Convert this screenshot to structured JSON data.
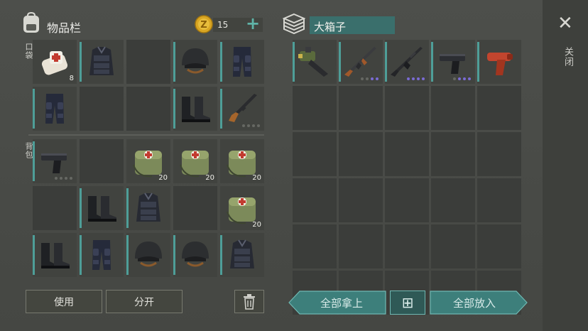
{
  "header": {
    "inventory_title": "物品栏",
    "coin_count": "15",
    "plus_glyph": "+",
    "box_title": "大箱子",
    "close_label": "关闭",
    "close_glyph": "✕"
  },
  "sections": {
    "pocket_label": "口袋",
    "backpack_label": "背包"
  },
  "pocket": [
    {
      "icon": "bandage-icon",
      "count": "8",
      "marked": false
    },
    {
      "icon": "body-armor-icon",
      "marked": true
    },
    {
      "icon": "",
      "marked": false
    },
    {
      "icon": "helmet-icon",
      "marked": true
    },
    {
      "icon": "armored-pants-icon",
      "marked": true
    },
    {
      "icon": "armored-pants-icon",
      "marked": true
    },
    {
      "icon": "",
      "marked": false
    },
    {
      "icon": "",
      "marked": false
    },
    {
      "icon": "boots-icon",
      "marked": true
    },
    {
      "icon": "shotgun-icon",
      "marked": true,
      "dots": [
        "g",
        "g",
        "g",
        "g"
      ]
    }
  ],
  "backpack": [
    {
      "icon": "pistol-icon",
      "marked": true,
      "dots": [
        "g",
        "g",
        "g",
        "g"
      ]
    },
    {
      "icon": "",
      "marked": false
    },
    {
      "icon": "medkit-bag-icon",
      "count": "20",
      "marked": false
    },
    {
      "icon": "medkit-bag-icon",
      "count": "20",
      "marked": false
    },
    {
      "icon": "medkit-bag-icon",
      "count": "20",
      "marked": false
    },
    {
      "icon": "",
      "marked": false
    },
    {
      "icon": "boots-icon",
      "marked": true
    },
    {
      "icon": "body-armor-icon",
      "marked": true
    },
    {
      "icon": "",
      "marked": false
    },
    {
      "icon": "medkit-bag-icon",
      "count": "20",
      "marked": false
    },
    {
      "icon": "boots-icon",
      "marked": true
    },
    {
      "icon": "armored-pants-icon",
      "marked": true
    },
    {
      "icon": "helmet-icon",
      "marked": true
    },
    {
      "icon": "helmet-icon",
      "marked": true
    },
    {
      "icon": "body-armor-icon",
      "marked": true
    }
  ],
  "box_items": [
    {
      "icon": "grenade-launcher-icon",
      "marked": true
    },
    {
      "icon": "ak-rifle-icon",
      "marked": true,
      "dots": [
        "g",
        "g",
        "p",
        "p"
      ]
    },
    {
      "icon": "m16-rifle-icon",
      "marked": true,
      "dots": [
        "p",
        "p",
        "p",
        "p"
      ]
    },
    {
      "icon": "pistol-icon",
      "marked": true,
      "dots": [
        "g",
        "p",
        "p",
        "p"
      ]
    },
    {
      "icon": "flare-gun-icon",
      "marked": true
    }
  ],
  "buttons": {
    "use": "使用",
    "split": "分开",
    "take_all": "全部拿上",
    "put_all": "全部放入",
    "grid_glyph": "⊞"
  },
  "colors": {
    "teal_accent": "#4e9e98",
    "teal_button": "#3d7f7b",
    "slot_bg": "#3b3d3a",
    "background": "#4a4c48",
    "rarity_purple": "#7a6bd4",
    "coin_gold": "#d9a623"
  }
}
